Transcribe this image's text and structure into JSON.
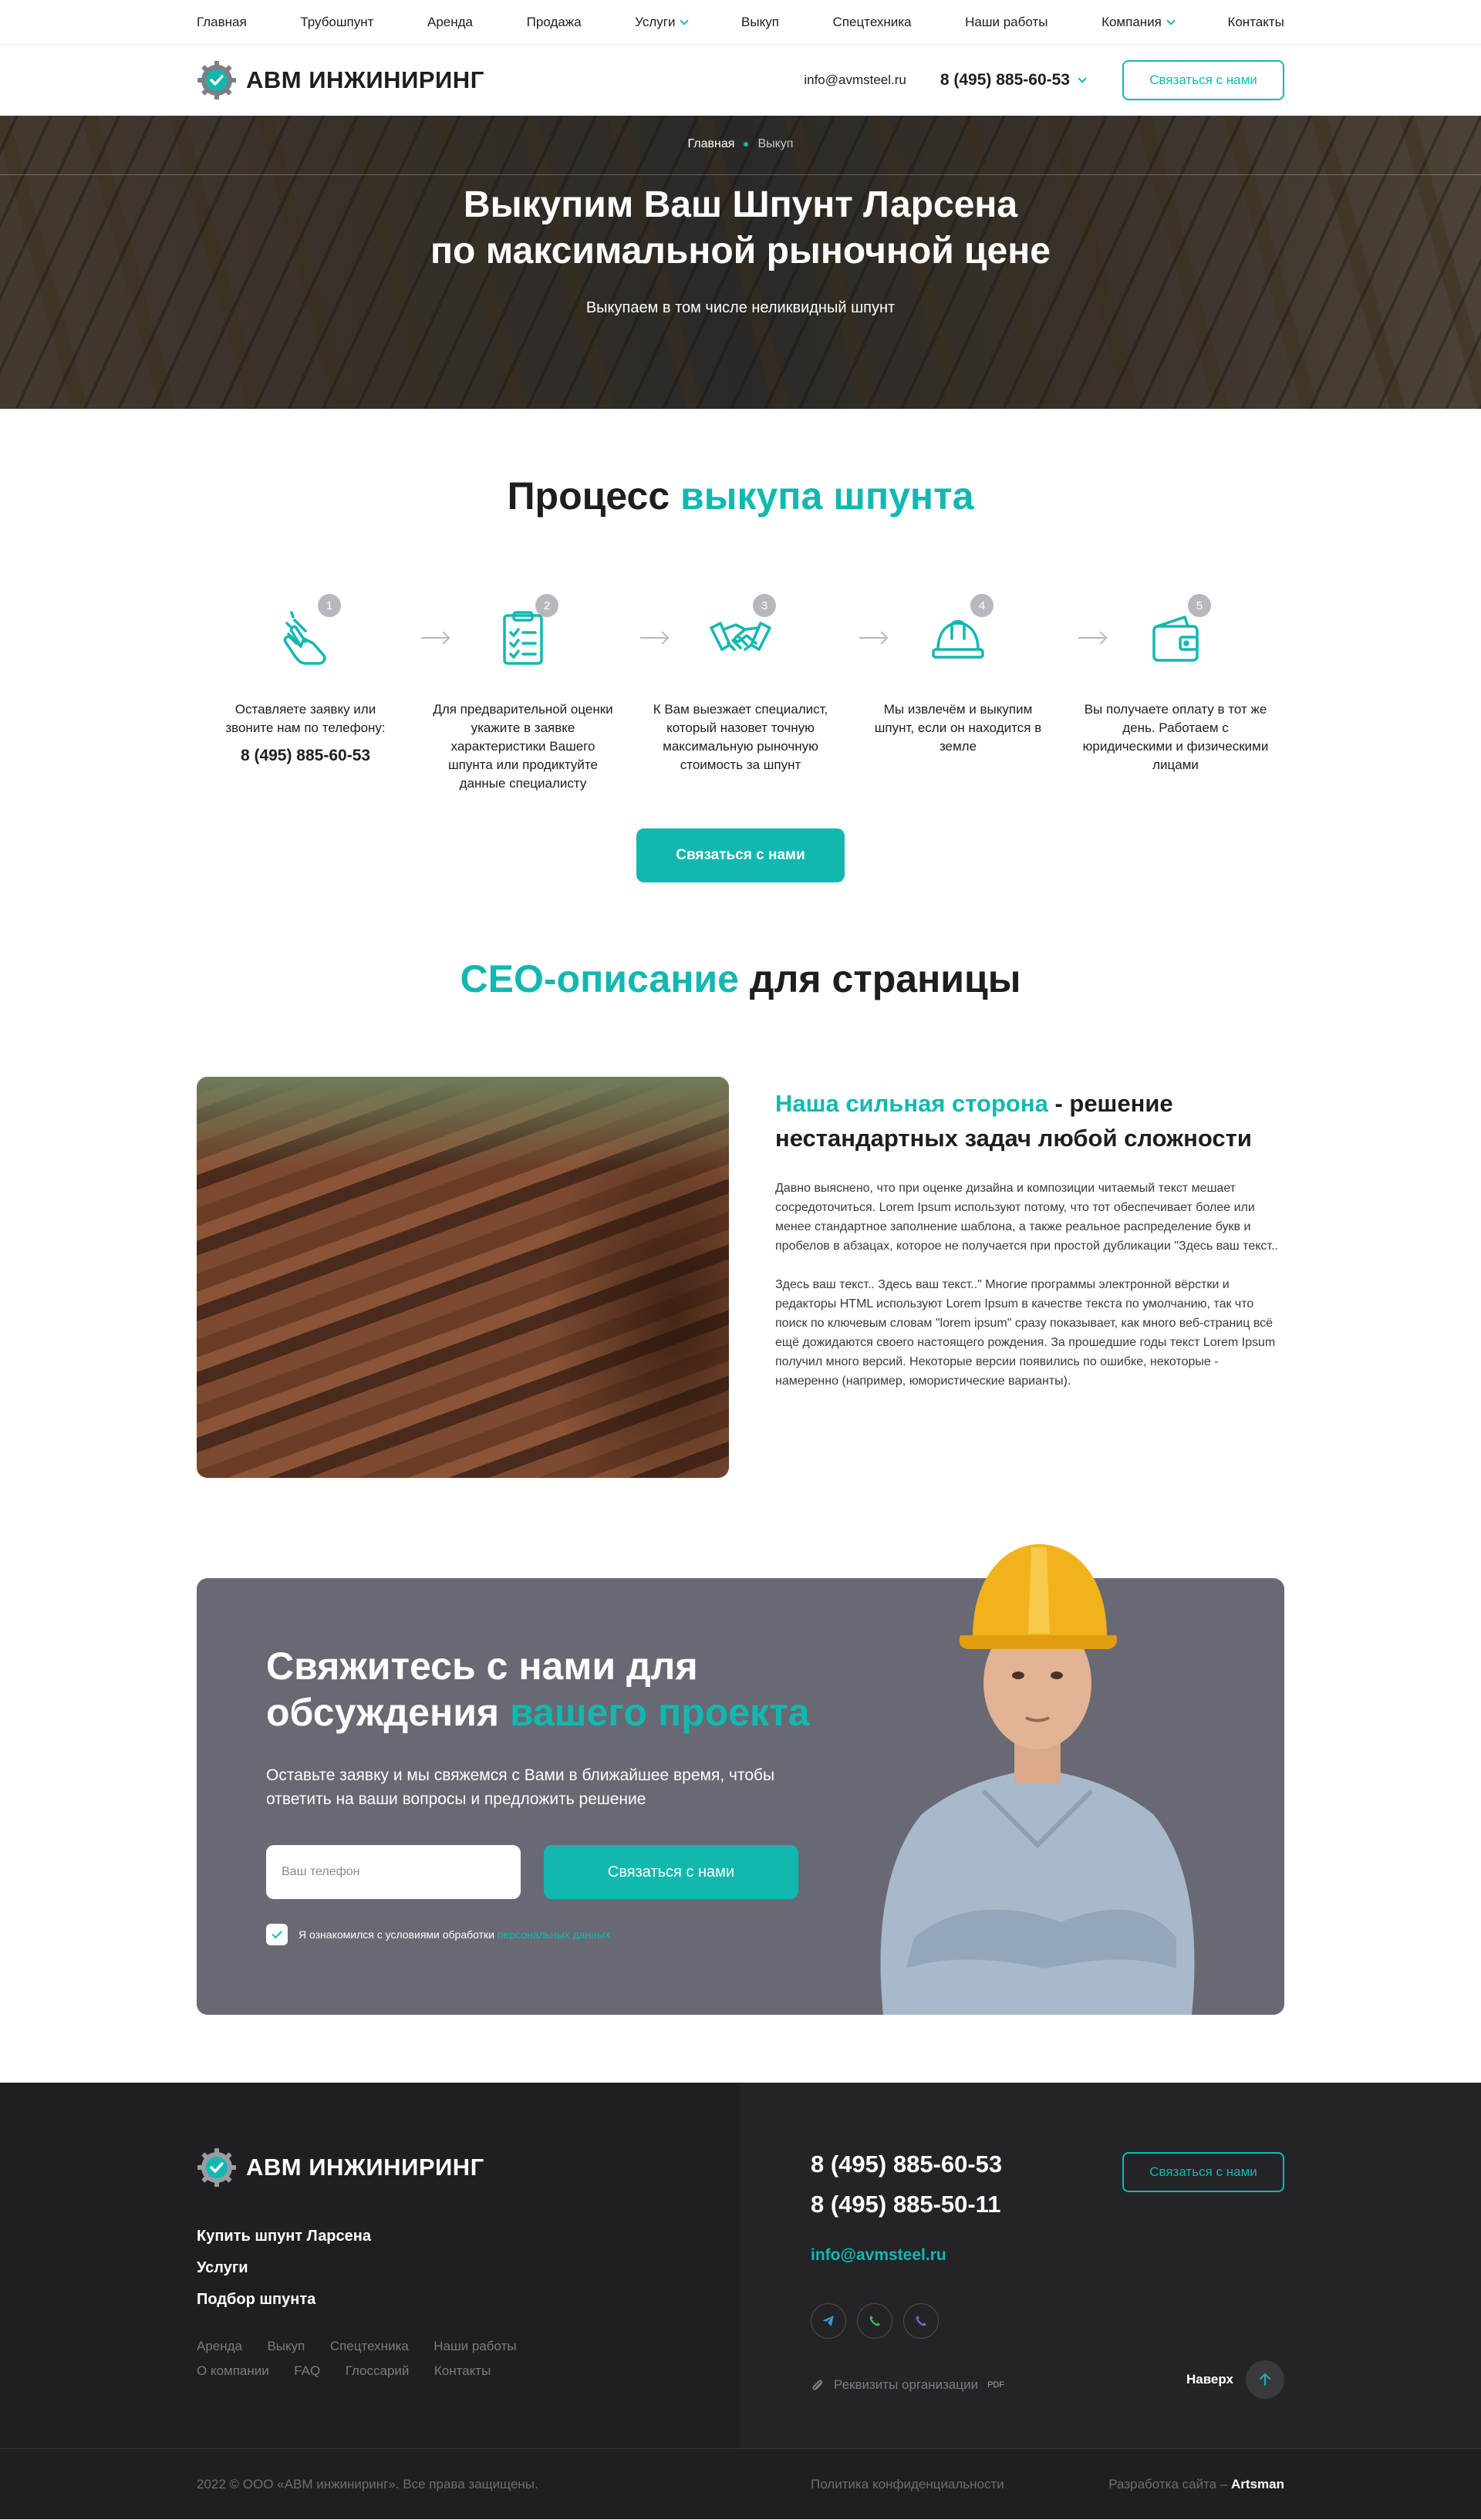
{
  "topnav": {
    "items": [
      "Главная",
      "Трубошпунт",
      "Аренда",
      "Продажа",
      "Услуги",
      "Выкуп",
      "Спецтехника",
      "Наши работы",
      "Компания",
      "Контакты"
    ]
  },
  "header": {
    "brand": "АВМ ИНЖИНИРИНГ",
    "email": "info@avmsteel.ru",
    "phone": "8 (495) 885-60-53",
    "cta": "Связаться с нами"
  },
  "hero": {
    "breadcrumb_home": "Главная",
    "breadcrumb_current": "Выкуп",
    "title_line1": "Выкупим Ваш Шпунт Ларсена",
    "title_line2": "по максимальной рыночной цене",
    "subtitle": "Выкупаем в том числе неликвидный шпунт"
  },
  "process": {
    "title_a": "Процесс ",
    "title_b": "выкупа шпунта",
    "steps": [
      {
        "num": "1",
        "text": "Оставляете заявку или звоните нам по телефону:",
        "phone": "8 (495) 885-60-53",
        "icon": "hand-tap-icon"
      },
      {
        "num": "2",
        "text": "Для предварительной оценки укажите в заявке характеристики Вашего шпунта или продиктуйте данные специалисту",
        "icon": "checklist-icon"
      },
      {
        "num": "3",
        "text": "К Вам выезжает специалист, который назовет точную максимальную рыночную стоимость за шпунт",
        "icon": "handshake-icon"
      },
      {
        "num": "4",
        "text": "Мы извлечём и выкупим шпунт, если он находится в земле",
        "icon": "hard-hat-icon"
      },
      {
        "num": "5",
        "text": "Вы получаете оплату в тот же день. Работаем с юридическими и физическими лицами",
        "icon": "wallet-icon"
      }
    ],
    "cta": "Связаться с нами"
  },
  "seo": {
    "title_a": "СЕО-описание",
    "title_b": " для страницы",
    "heading_a": "Наша сильная сторона",
    "heading_b": " - решение нестандартных задач любой сложности",
    "p1": "Давно выяснено, что при оценке дизайна и композиции читаемый текст мешает сосредоточиться. Lorem Ipsum используют потому, что тот обеспечивает более или менее стандартное заполнение шаблона, а также реальное распределение букв и пробелов в абзацах, которое не получается при простой дубликации \"Здесь ваш текст..",
    "p2": "Здесь ваш текст.. Здесь ваш текст..\" Многие программы электронной вёрстки и редакторы HTML используют Lorem Ipsum в качестве текста по умолчанию, так что поиск по ключевым словам \"lorem ipsum\" сразу показывает, как много веб-страниц всё ещё дожидаются своего настоящего рождения. За прошедшие годы текст Lorem Ipsum получил много версий. Некоторые версии появились по ошибке, некоторые - намеренно (например, юмористические варианты)."
  },
  "contact": {
    "title_line1": "Свяжитесь с нами для",
    "title_line2a": "обсуждения ",
    "title_line2b": "вашего проекта",
    "lead": "Оставьте заявку и мы свяжемся с Вами в ближайшее время, чтобы ответить на ваши вопросы и предложить решение",
    "phone_placeholder": "Ваш телефон",
    "submit": "Связаться с нами",
    "agree_text": "Я ознакомился с условиями обработки ",
    "agree_link": "персональных данных"
  },
  "footer": {
    "brand": "АВМ ИНЖИНИРИНГ",
    "main_links": [
      "Купить шпунт Ларсена",
      "Услуги",
      "Подбор шпунта"
    ],
    "small_links": [
      "Аренда",
      "Выкуп",
      "Спецтехника",
      "Наши работы",
      "О компании",
      "FAQ",
      "Глоссарий",
      "Контакты"
    ],
    "phone1": "8 (495) 885-60-53",
    "phone2": "8 (495) 885-50-11",
    "email": "info@avmsteel.ru",
    "cta": "Связаться с нами",
    "requisites": "Реквизиты организации",
    "pdf": "PDF",
    "to_top": "Наверх",
    "copyright": "2022 © ООО «АВМ инжиниринг». Все права защищены.",
    "policy": "Политика конфиденциальности",
    "dev_label": "Разработка сайта – ",
    "dev_name": "Artsman"
  },
  "colors": {
    "accent": "#12b8b0",
    "dark": "#1f1f22",
    "contact_bg": "#686973"
  }
}
